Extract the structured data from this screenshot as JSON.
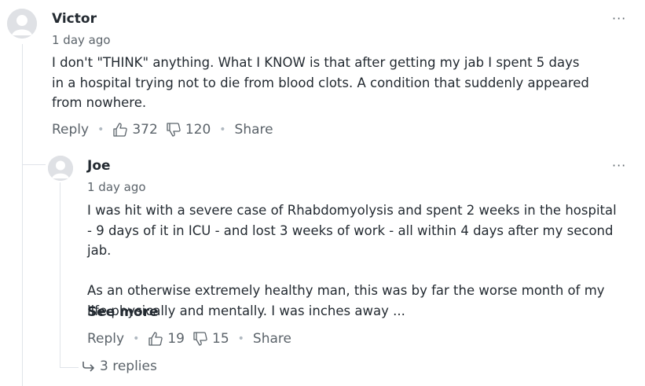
{
  "comments": [
    {
      "author": "Victor",
      "time": "1 day ago",
      "text": [
        "I don't \"THINK\" anything.  What I KNOW is that after getting my jab I spent 5 days in a hospital trying not to die from blood clots.  A condition that suddenly appeared from nowhere."
      ],
      "reply_label": "Reply",
      "upvotes": "372",
      "downvotes": "120",
      "share_label": "Share",
      "more_label": "···"
    },
    {
      "author": "Joe",
      "time": "1 day ago",
      "text": [
        "I was hit with a severe case of Rhabdomyolysis and spent 2 weeks in the hospital  - 9 days of it in ICU - and lost 3 weeks of work - all within 4 days after my second jab.",
        "As an otherwise extremely healthy man, this was by far the worse month of my life physically and mentally.  I was inches away ..."
      ],
      "see_more_label": "See more",
      "reply_label": "Reply",
      "upvotes": "19",
      "downvotes": "15",
      "share_label": "Share",
      "more_label": "···",
      "replies_label": "3 replies"
    }
  ],
  "icons": {
    "avatar": "user-avatar-icon",
    "thumbs_up": "thumbs-up-icon",
    "thumbs_down": "thumbs-down-icon",
    "reply_arrow": "reply-arrow-icon"
  }
}
